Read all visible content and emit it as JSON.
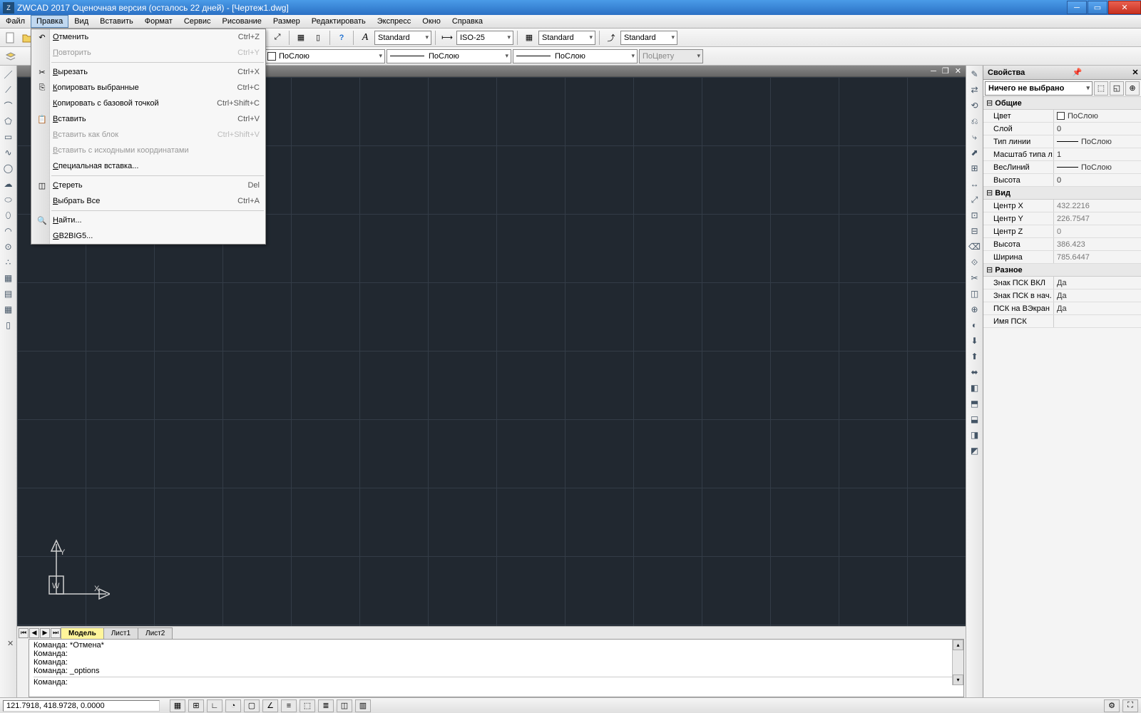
{
  "title": "ZWCAD 2017 Оценочная версия (осталось 22 дней) - [Чертеж1.dwg]",
  "menu": [
    "Файл",
    "Правка",
    "Вид",
    "Вставить",
    "Формат",
    "Сервис",
    "Рисование",
    "Размер",
    "Редактировать",
    "Экспресс",
    "Окно",
    "Справка"
  ],
  "activeMenu": 1,
  "dropdown": [
    {
      "type": "item",
      "label": "Отменить",
      "shortcut": "Ctrl+Z",
      "icon": "undo"
    },
    {
      "type": "item",
      "label": "Повторить",
      "shortcut": "Ctrl+Y",
      "disabled": true
    },
    {
      "type": "sep"
    },
    {
      "type": "item",
      "label": "Вырезать",
      "shortcut": "Ctrl+X",
      "icon": "cut"
    },
    {
      "type": "item",
      "label": "Копировать выбранные",
      "shortcut": "Ctrl+C",
      "icon": "copy"
    },
    {
      "type": "item",
      "label": "Копировать с базовой точкой",
      "shortcut": "Ctrl+Shift+C"
    },
    {
      "type": "item",
      "label": "Вставить",
      "shortcut": "Ctrl+V",
      "icon": "paste"
    },
    {
      "type": "item",
      "label": "Вставить как блок",
      "shortcut": "Ctrl+Shift+V",
      "disabled": true
    },
    {
      "type": "item",
      "label": "Вставить с исходными координатами",
      "disabled": true
    },
    {
      "type": "item",
      "label": "Специальная вставка..."
    },
    {
      "type": "sep"
    },
    {
      "type": "item",
      "label": "Стереть",
      "shortcut": "Del",
      "icon": "erase"
    },
    {
      "type": "item",
      "label": "Выбрать Все",
      "shortcut": "Ctrl+A"
    },
    {
      "type": "sep"
    },
    {
      "type": "item",
      "label": "Найти...",
      "icon": "find"
    },
    {
      "type": "item",
      "label": "GB2BIG5..."
    }
  ],
  "combos": {
    "textStyle": "Standard",
    "dimStyle": "ISO-25",
    "tableStyle": "Standard",
    "mlStyle": "Standard",
    "layerColor": "ПоСлою",
    "linetype": "ПоСлою",
    "lineweight": "ПоСлою",
    "plotColor": "ПоЦвету"
  },
  "tabs": {
    "items": [
      "Модель",
      "Лист1",
      "Лист2"
    ],
    "active": 0
  },
  "cmd": {
    "lines": [
      "Команда: *Отмена*",
      "Команда:",
      "Команда:",
      "Команда: _options"
    ],
    "prompt": "Команда:"
  },
  "props": {
    "title": "Свойства",
    "selection": "Ничего не выбрано",
    "groups": [
      {
        "name": "Общие",
        "rows": [
          {
            "k": "Цвет",
            "v": "ПоСлою",
            "swatch": true
          },
          {
            "k": "Слой",
            "v": "0"
          },
          {
            "k": "Тип линии",
            "v": "ПоСлою",
            "line": true
          },
          {
            "k": "Масштаб типа л...",
            "v": "1"
          },
          {
            "k": "ВесЛиний",
            "v": "ПоСлою",
            "line": true
          },
          {
            "k": "Высота",
            "v": "0"
          }
        ]
      },
      {
        "name": "Вид",
        "rows": [
          {
            "k": "Центр X",
            "v": "432.2216",
            "ro": true
          },
          {
            "k": "Центр Y",
            "v": "226.7547",
            "ro": true
          },
          {
            "k": "Центр Z",
            "v": "0",
            "ro": true
          },
          {
            "k": "Высота",
            "v": "386.423",
            "ro": true
          },
          {
            "k": "Ширина",
            "v": "785.6447",
            "ro": true
          }
        ]
      },
      {
        "name": "Разное",
        "rows": [
          {
            "k": "Знак ПСК ВКЛ",
            "v": "Да"
          },
          {
            "k": "Знак ПСК в нач. ...",
            "v": "Да"
          },
          {
            "k": "ПСК на ВЭкран",
            "v": "Да"
          },
          {
            "k": "Имя ПСК",
            "v": ""
          }
        ]
      }
    ]
  },
  "status": {
    "coords": "121.7918, 418.9728, 0.0000"
  }
}
